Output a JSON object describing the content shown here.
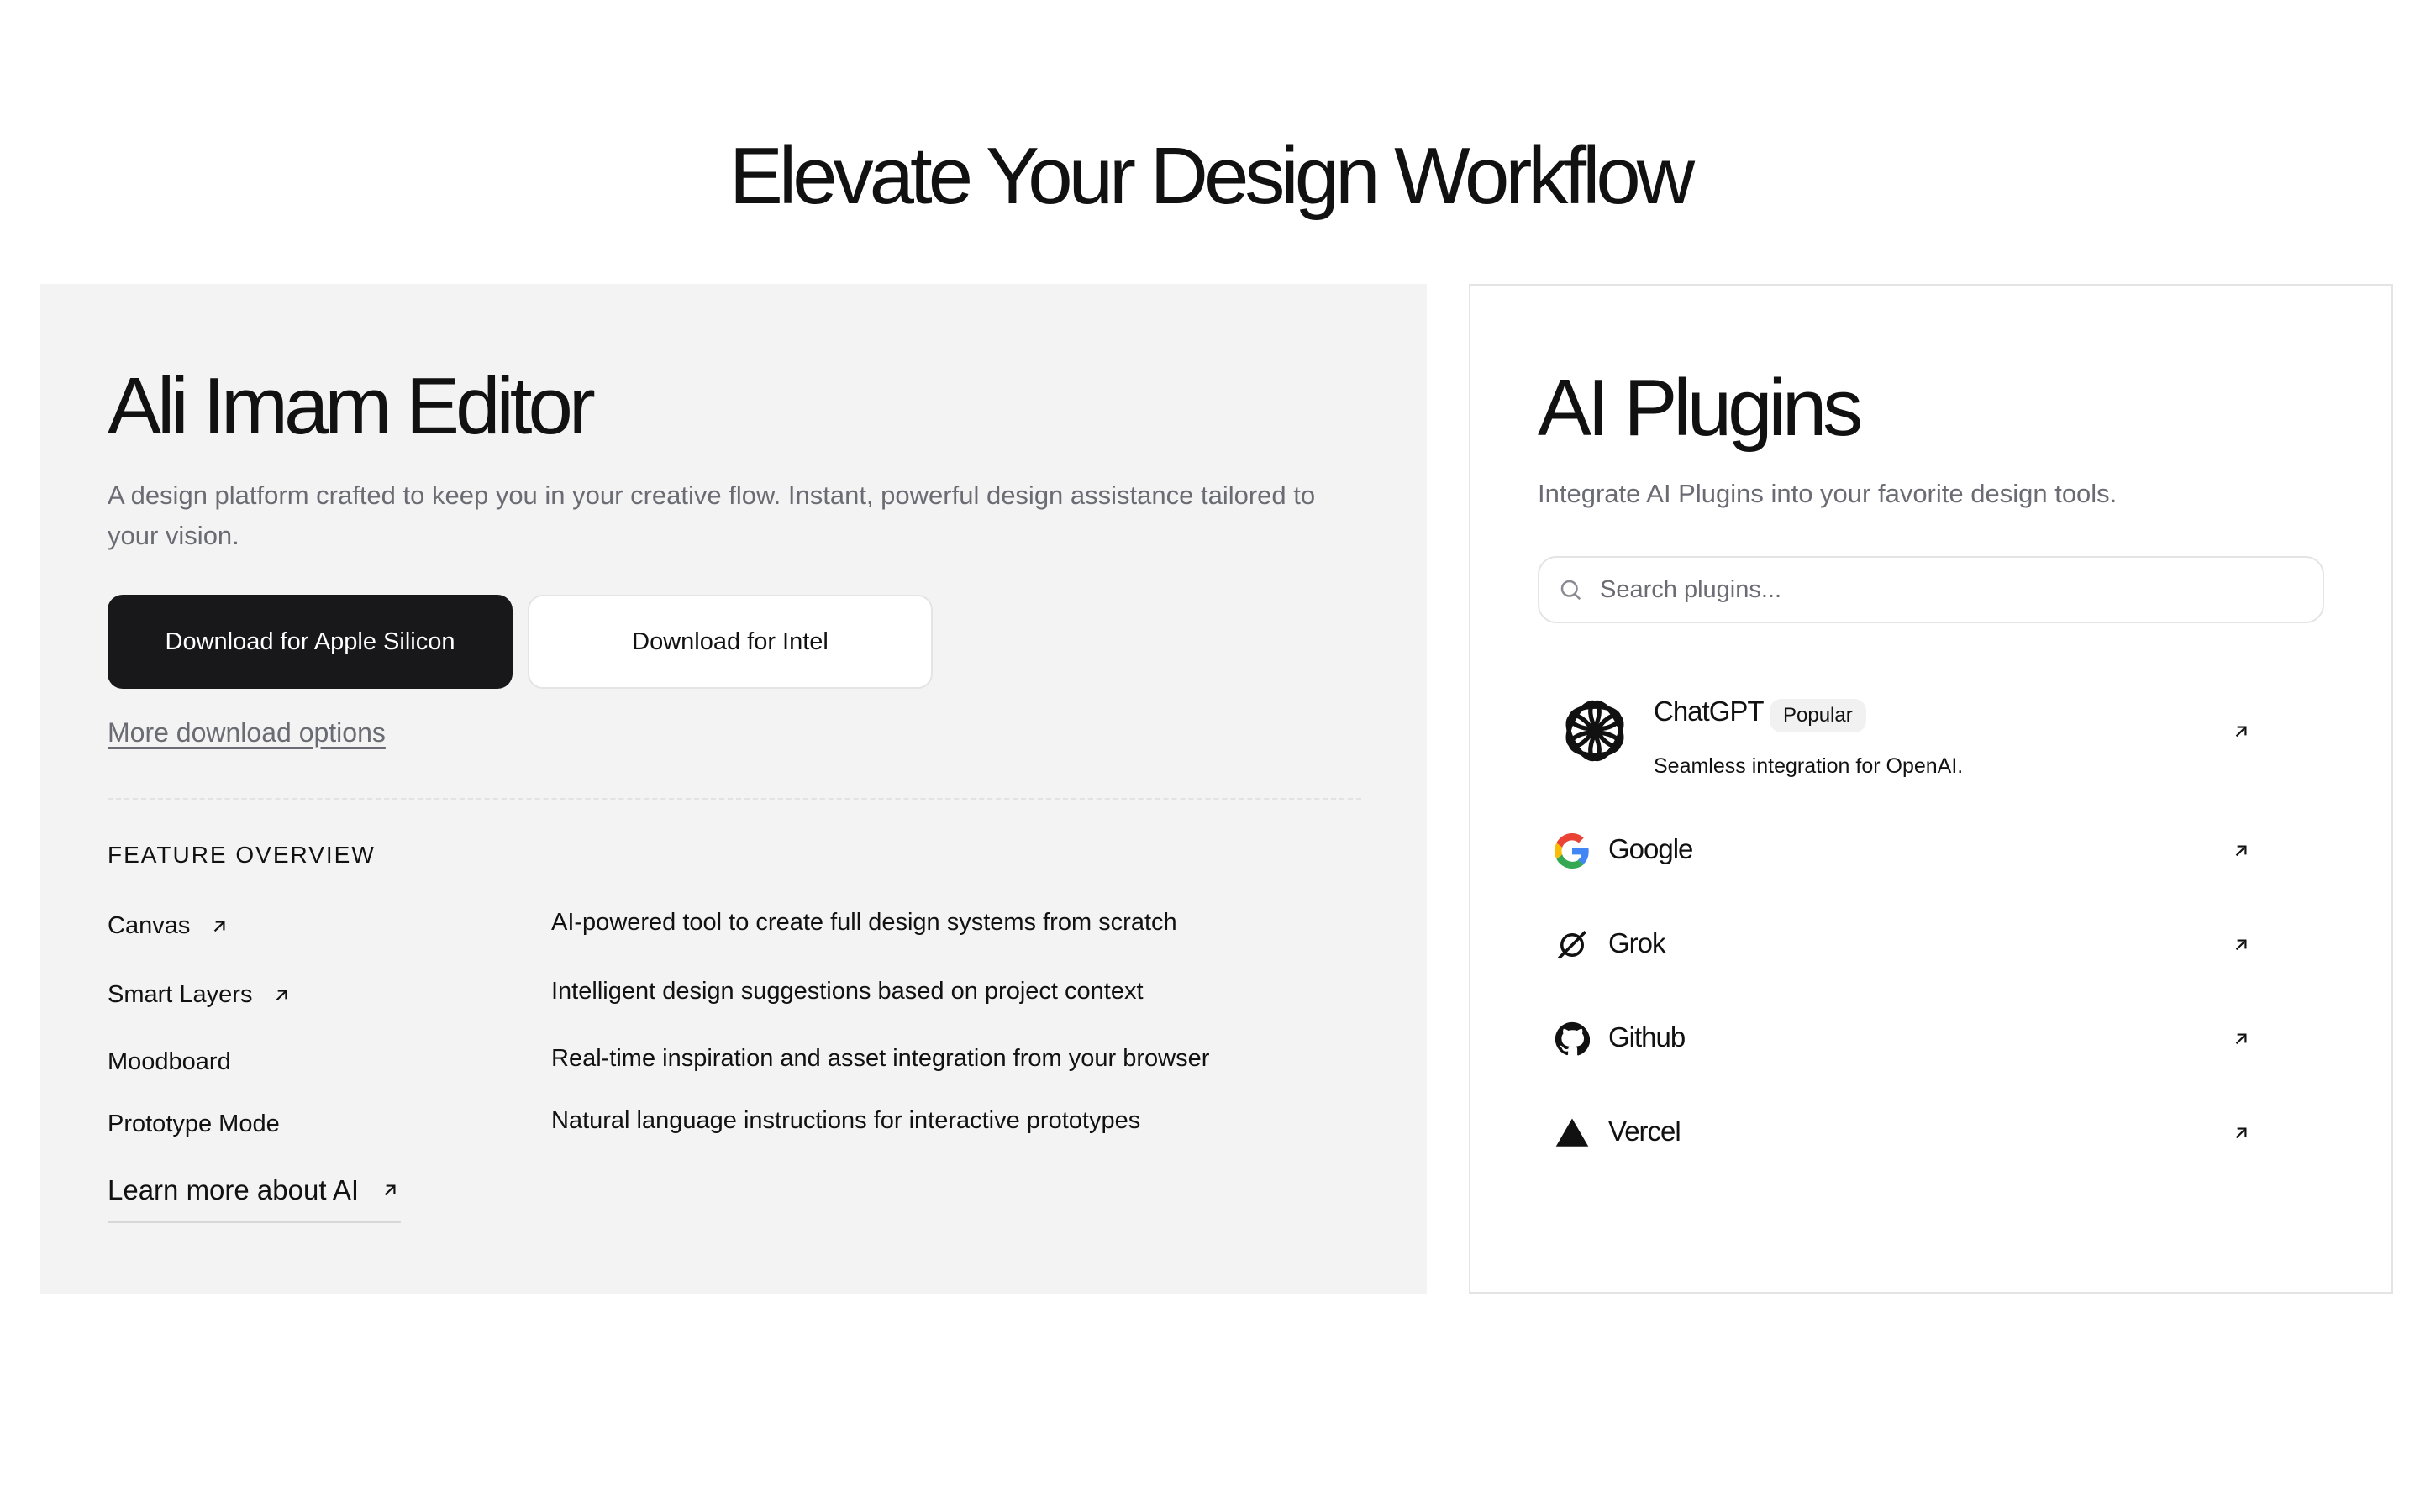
{
  "page": {
    "title": "Elevate Your Design Workflow"
  },
  "editor": {
    "title": "Ali Imam Editor",
    "description": "A design platform crafted to keep you in your creative flow. Instant, powerful design assistance tailored to your vision.",
    "primary_button": "Download for Apple Silicon",
    "secondary_button": "Download for Intel",
    "more_link": "More download options",
    "features_heading": "FEATURE OVERVIEW",
    "features": [
      {
        "name": "Canvas",
        "desc": "AI-powered tool to create full design systems from scratch",
        "icon": "arrow-up-right-icon"
      },
      {
        "name": "Smart Layers",
        "desc": "Intelligent design suggestions based on project context",
        "icon": "arrow-up-right-icon"
      },
      {
        "name": "Moodboard",
        "desc": "Real-time inspiration and asset integration from your browser"
      },
      {
        "name": "Prototype Mode",
        "desc": "Natural language instructions for interactive prototypes"
      }
    ],
    "learn_more": "Learn more about AI"
  },
  "plugins": {
    "title": "AI Plugins",
    "description": "Integrate AI Plugins into your favorite design tools.",
    "search_placeholder": "Search plugins...",
    "items": [
      {
        "name": "ChatGPT",
        "badge": "Popular",
        "sub": "Seamless integration for OpenAI.",
        "icon": "openai-icon"
      },
      {
        "name": "Google",
        "icon": "google-icon"
      },
      {
        "name": "Grok",
        "icon": "grok-icon"
      },
      {
        "name": "Github",
        "icon": "github-icon"
      },
      {
        "name": "Vercel",
        "icon": "vercel-icon"
      }
    ]
  },
  "colors": {
    "card_bg": "#f3f3f3",
    "primary_button_bg": "#18181b",
    "muted_text": "#6b6b73",
    "border": "#e4e4e7"
  }
}
